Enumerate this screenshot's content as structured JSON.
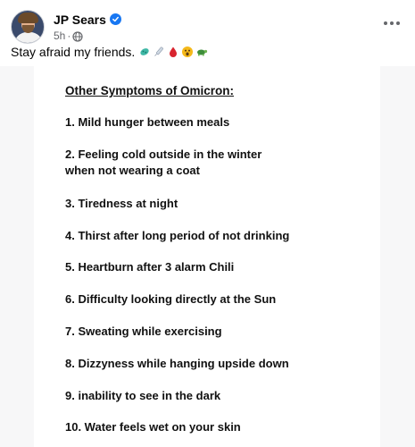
{
  "post": {
    "author": "JP Sears",
    "verified_icon": "verified-badge-icon",
    "timestamp": "5h",
    "separator": "·",
    "audience_icon": "globe-icon",
    "caption": "Stay afraid my friends.",
    "caption_emojis": [
      "microbe-icon",
      "syringe-icon",
      "drop-of-blood-icon",
      "astonished-face-icon",
      "turtle-icon"
    ],
    "more_icon": "more-options-icon"
  },
  "image": {
    "title": "Other Symptoms of Omicron:",
    "items": [
      "1. Mild hunger between meals",
      "2. Feeling cold outside in the winter",
      "when not wearing a coat",
      "3. Tiredness at night",
      "4. Thirst after long period of not drinking",
      "5. Heartburn after 3 alarm Chili",
      "6. Difficulty looking directly at the Sun",
      "7. Sweating while exercising",
      "8. Dizzyness while hanging upside down",
      "9. inability to see in the dark",
      "10. Water feels wet on your skin"
    ]
  },
  "colors": {
    "accent": "#1877f2",
    "secondary_text": "#65676b",
    "page_background": "#f0f2f5"
  }
}
